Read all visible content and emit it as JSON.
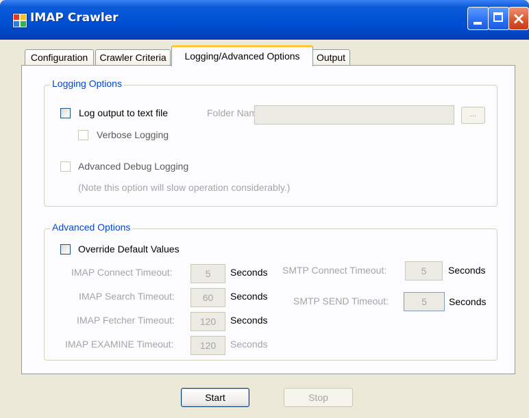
{
  "window": {
    "title": "IMAP Crawler"
  },
  "tabs": [
    {
      "label": "Configuration"
    },
    {
      "label": "Crawler Criteria"
    },
    {
      "label": "Logging/Advanced Options",
      "selected": true
    },
    {
      "label": "Output"
    }
  ],
  "logging": {
    "legend": "Logging Options",
    "log_output_label": "Log output to text file",
    "log_output_checked": false,
    "folder_label": "Folder Name:",
    "folder_value": "",
    "browse_label": "...",
    "verbose_label": "Verbose Logging",
    "verbose_checked": false,
    "debug_label": "Advanced Debug Logging",
    "debug_checked": false,
    "note": "(Note this option will slow operation considerably.)"
  },
  "advanced": {
    "legend": "Advanced Options",
    "override_label": "Override Default Values",
    "override_checked": false,
    "seconds": "Seconds",
    "imap_connect": {
      "label": "IMAP Connect Timeout:",
      "value": "5"
    },
    "imap_search": {
      "label": "IMAP Search Timeout:",
      "value": "60"
    },
    "imap_fetcher": {
      "label": "IMAP Fetcher Timeout:",
      "value": "120"
    },
    "imap_examine": {
      "label": "IMAP EXAMINE Timeout:",
      "value": "120"
    },
    "smtp_connect": {
      "label": "SMTP Connect Timeout:",
      "value": "5"
    },
    "smtp_send": {
      "label": "SMTP SEND Timeout:",
      "value": "5"
    }
  },
  "buttons": {
    "start": "Start",
    "stop": "Stop"
  },
  "colors": {
    "titlebar": "#0050d4",
    "legend_text": "#0046d5",
    "disabled_text": "#a5a5a5"
  },
  "icons": [
    "app-icon",
    "minimize-icon",
    "maximize-icon",
    "close-icon"
  ]
}
